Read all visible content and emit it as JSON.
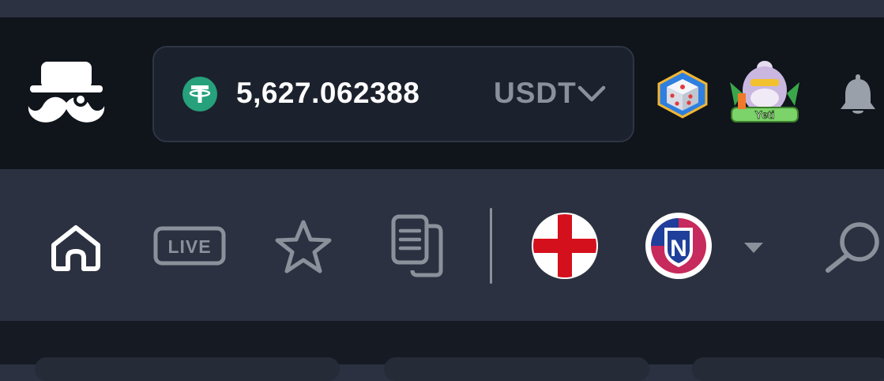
{
  "wallet": {
    "balance": "5,627.062388",
    "currency": "USDT",
    "coin_icon": "tether-icon",
    "chevron_icon": "chevron-down-icon"
  },
  "header": {
    "icons": [
      "mustache-logo-icon",
      "dice-badge-icon",
      "yeti-game-icon",
      "bell-icon"
    ],
    "yeti_label": "Yeti"
  },
  "nav": {
    "items": [
      "home-icon",
      "live-icon",
      "star-icon",
      "documents-icon",
      "england-flag-icon",
      "team-n-icon",
      "caret-down-icon",
      "search-icon"
    ],
    "live_label": "LIVE",
    "team_label": "N"
  },
  "colors": {
    "header_bg": "#10141b",
    "nav_bg": "#2b3140",
    "tether": "#26a17b",
    "muted": "#8a919d"
  }
}
